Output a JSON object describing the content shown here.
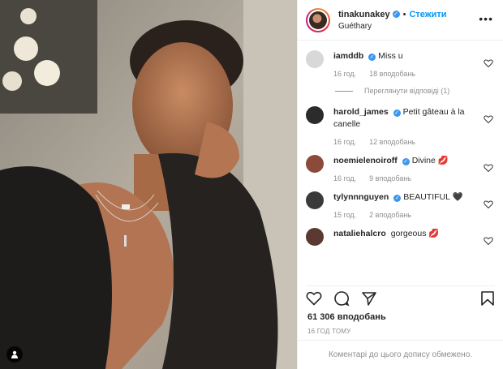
{
  "header": {
    "username": "tinakunakey",
    "dot": "•",
    "follow_label": "Стежити",
    "location": "Guéthary",
    "more_label": "•••"
  },
  "comments": [
    {
      "user": "iamddb",
      "text": "Miss u",
      "time": "16 год.",
      "likes": "18 вподобань",
      "avatar_color": "#d8d8d8"
    },
    {
      "user": "harold_james",
      "text": "Petit gâteau à la canelle",
      "time": "16 год.",
      "likes": "12 вподобань",
      "avatar_color": "#2b2b2b"
    },
    {
      "user": "noemielenoiroff",
      "text": "Divine 💋",
      "time": "16 год.",
      "likes": "9 вподобань",
      "avatar_color": "#8b4a3a"
    },
    {
      "user": "tylynnnguyen",
      "text": "BEAUTIFUL 🖤",
      "time": "15 год.",
      "likes": "2 вподобань",
      "avatar_color": "#3a3a3a"
    },
    {
      "user": "nataliehalcro",
      "text": "gorgeous 💋",
      "time": "",
      "likes": "",
      "avatar_color": "#5a3a30"
    }
  ],
  "replies_label": "Переглянути відповіді (1)",
  "likes_count": "61 306 вподобань",
  "post_time": "16 ГОД ТОМУ",
  "comments_disabled": "Коментарі до цього допису обмежено."
}
